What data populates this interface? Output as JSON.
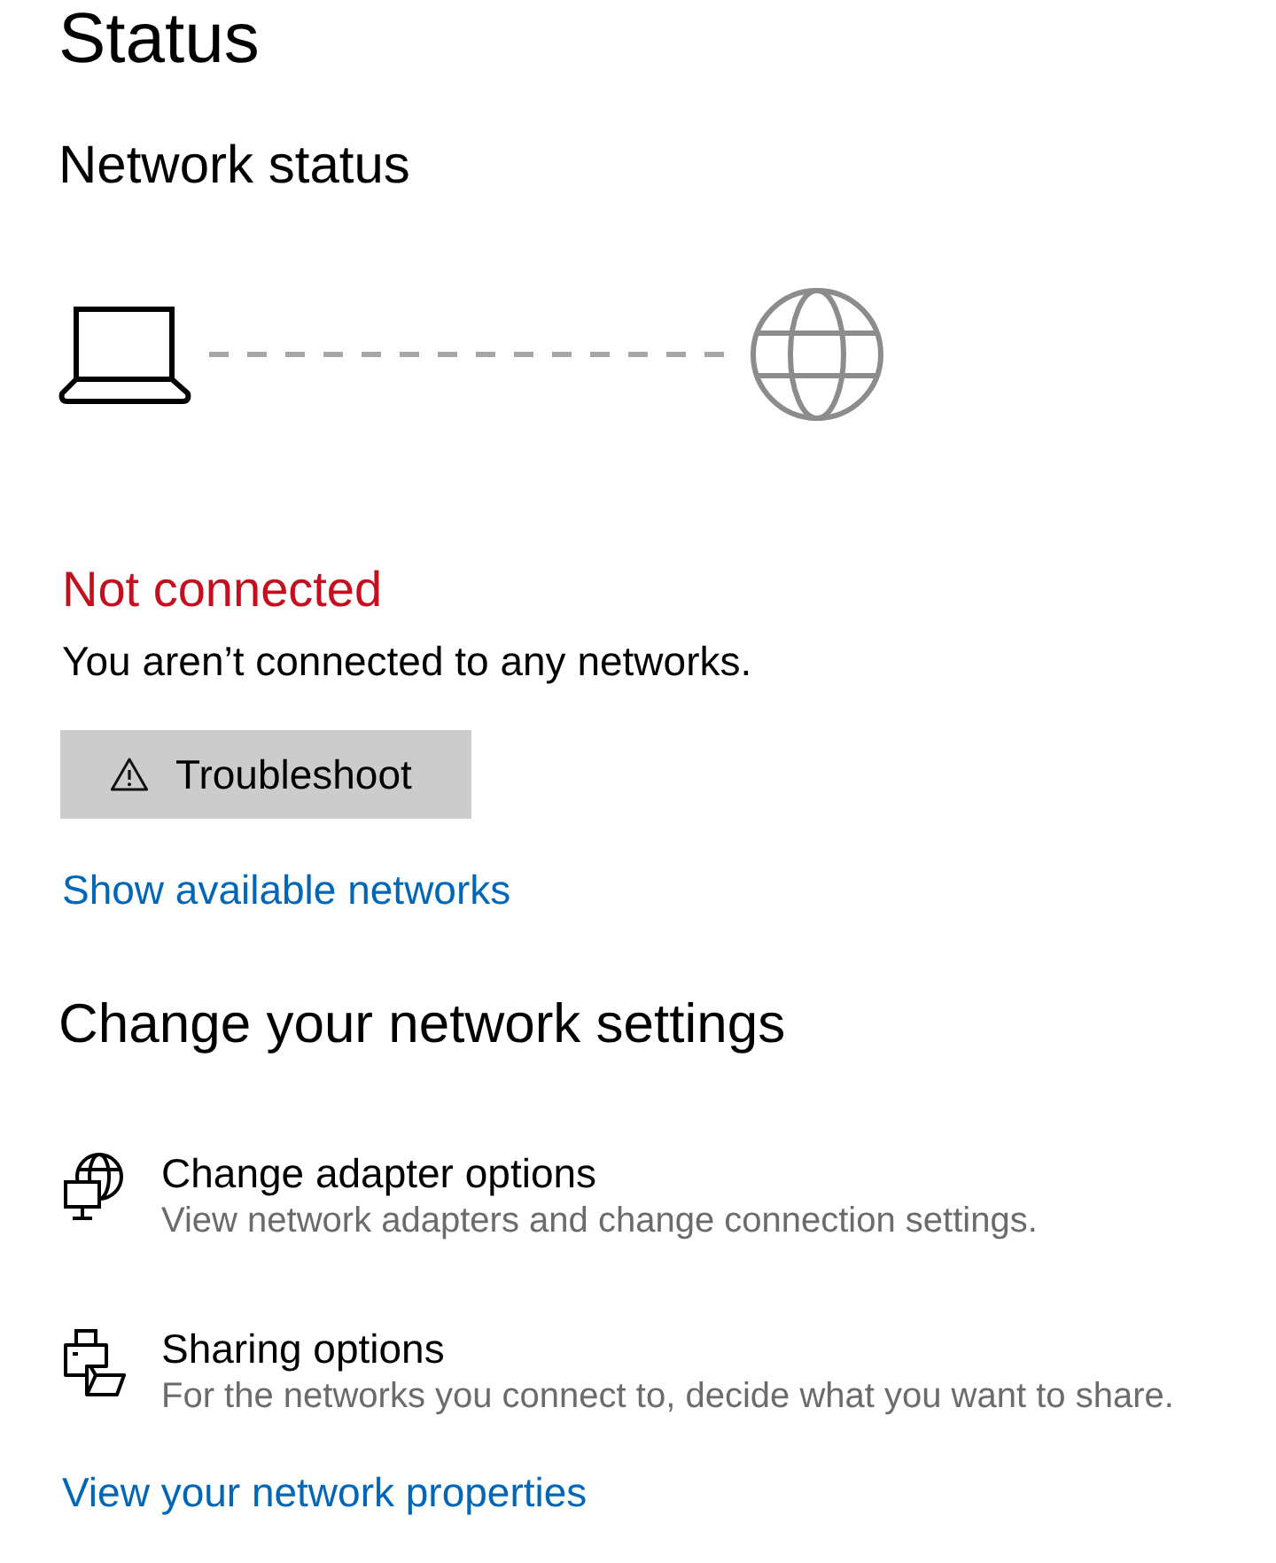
{
  "page": {
    "title": "Status"
  },
  "network_status": {
    "heading": "Network status",
    "connected": false,
    "state": "Not connected",
    "message": "You aren’t connected to any networks.",
    "troubleshoot_button": {
      "label": "Troubleshoot"
    },
    "link": "Show available networks"
  },
  "change_settings": {
    "heading": "Change your network settings",
    "items": [
      {
        "kind": "adapter",
        "title": "Change adapter options",
        "description": "View network adapters and change connection settings."
      },
      {
        "kind": "sharing",
        "title": "Sharing options",
        "description": "For the networks you connect to, decide what you want to share."
      }
    ],
    "link": "View your network properties"
  }
}
